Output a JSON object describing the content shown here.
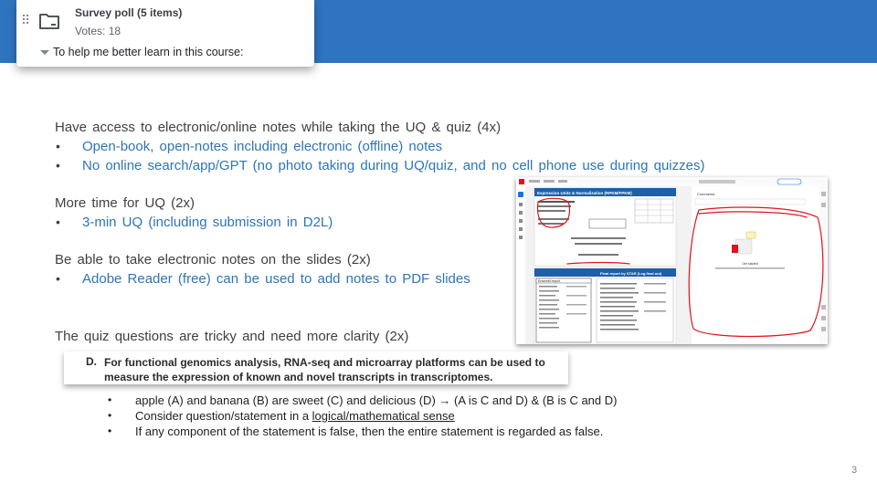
{
  "poll": {
    "title": "Survey poll (5 items)",
    "votes": "Votes: 18",
    "question": "To help me better learn in this course:"
  },
  "slide": {
    "item1": {
      "heading": "Have access to electronic/online notes while taking the UQ & quiz (4x)",
      "bullets": [
        "Open-book, open-notes including electronic (offline) notes",
        "No online search/app/GPT (no photo taking during UQ/quiz, and no cell phone use during quizzes)"
      ]
    },
    "item2": {
      "heading": "More time for UQ (2x)",
      "bullets": [
        "3-min UQ (including submission in D2L)"
      ]
    },
    "item3": {
      "heading": "Be able to take electronic notes on the slides (2x)",
      "bullets": [
        "Adobe Reader (free) can be used to add notes to PDF slides"
      ]
    },
    "item4": {
      "heading": "The quiz questions are tricky and need more clarity (2x)"
    },
    "example": {
      "letter": "D.",
      "text": "For functional genomics analysis, RNA-seq and microarray platforms can be used to measure the expression of known and novel transcripts in transcriptomes."
    },
    "sub_bullets": {
      "b1_pre": "apple (A) and banana (B) are sweet (C) and delicious (D)",
      "b1_arrow": "→",
      "b1_post": "(A is C and D) & (B is C and D)",
      "b2_pre": "Consider question/statement in a ",
      "b2_link": "logical/mathematical sense",
      "b3": "If any component of the statement is false, then the entire statement is regarded as false."
    },
    "page_number": "3"
  },
  "screenshot": {
    "left_title": "Expression Units & Normalization (RPKM/FPKM)",
    "lower_left_title": "Ensembl report",
    "lower_right_title": "Final report by STAR (Log.final.out)",
    "panel_title": "Comments",
    "panel_subtitle": "Get started",
    "brand_color": "#1f5fa8",
    "annotation_color": "#e0141e"
  }
}
